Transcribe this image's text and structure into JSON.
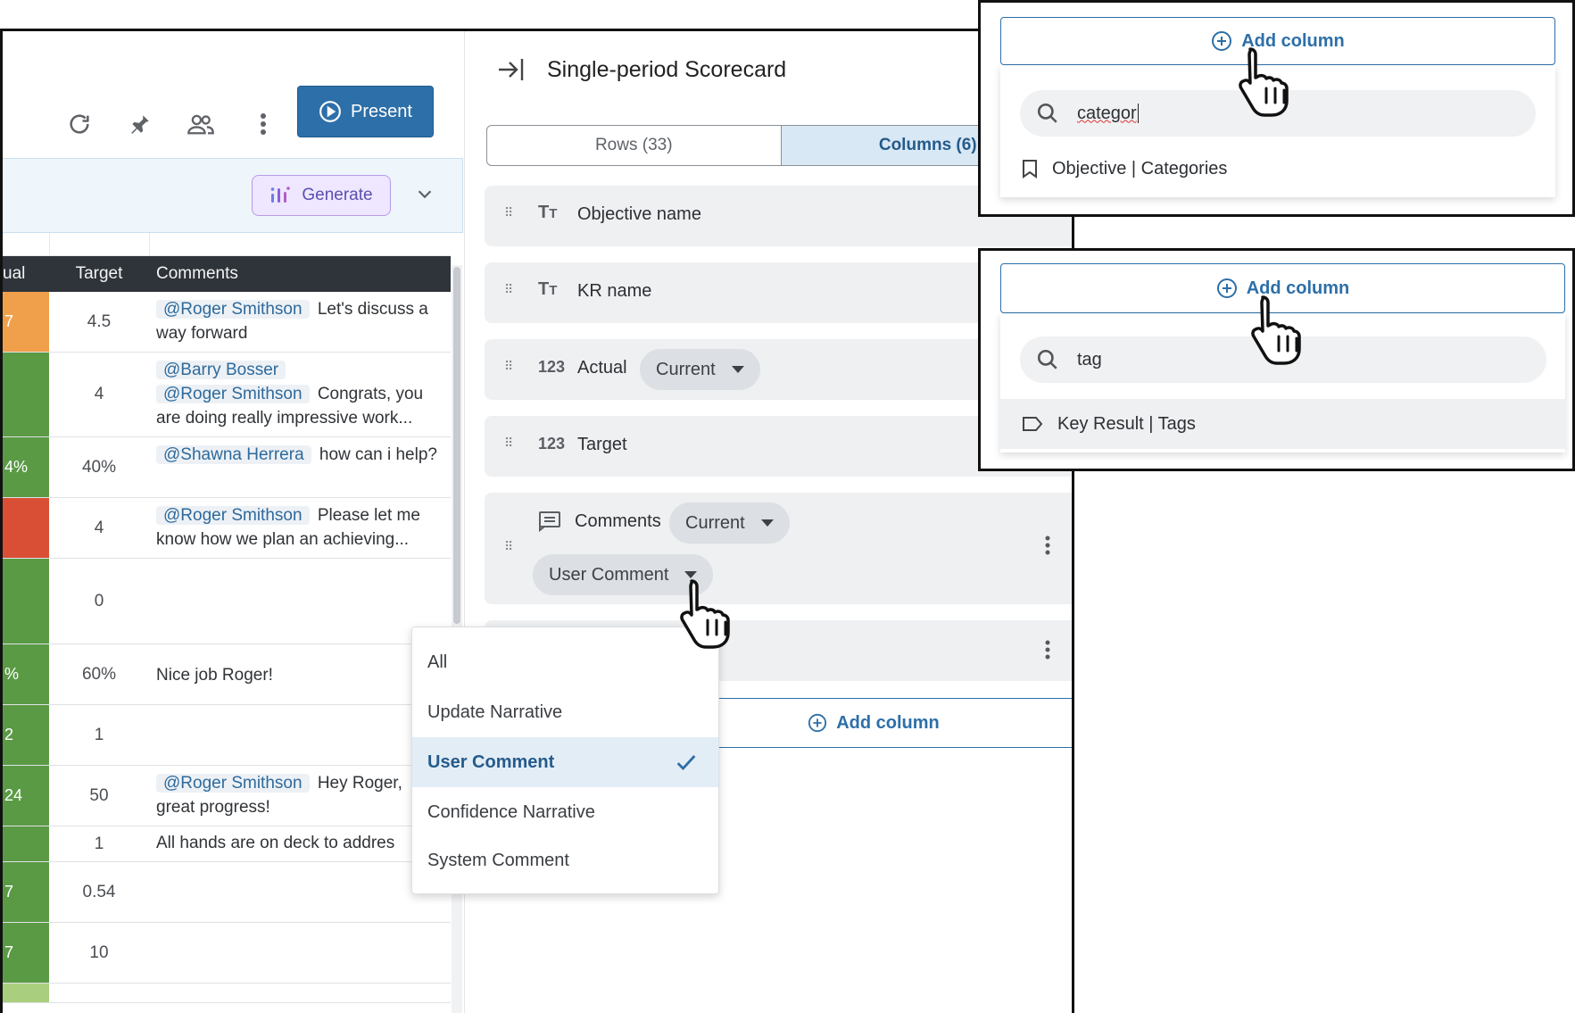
{
  "toolbar": {
    "present_label": "Present",
    "generate_label": "Generate"
  },
  "table": {
    "headers": {
      "actual": "ual",
      "target": "Target",
      "comments": "Comments"
    },
    "rows": [
      {
        "actual": "7",
        "actual_color": "#f0a04b",
        "target": "4.5",
        "mentions": [
          "@Roger Smithson"
        ],
        "text": "Let's discuss a way forward"
      },
      {
        "actual": "",
        "actual_color": "#5a9a45",
        "target": "4",
        "mentions": [
          "@Barry Bosser",
          "@Roger Smithson"
        ],
        "text": "Congrats, you are doing really impressive work..."
      },
      {
        "actual": "4%",
        "actual_color": "#5a9a45",
        "target": "40%",
        "mentions": [
          "@Shawna Herrera"
        ],
        "text": "how can i help?"
      },
      {
        "actual": "",
        "actual_color": "#d94f35",
        "target": "4",
        "mentions": [
          "@Roger Smithson"
        ],
        "text": "Please let me know how we plan an achieving..."
      },
      {
        "actual": "",
        "actual_color": "#5a9a45",
        "target": "0",
        "mentions": [],
        "text": ""
      },
      {
        "actual": "%",
        "actual_color": "#5a9a45",
        "target": "60%",
        "mentions": [],
        "text": "Nice job Roger!"
      },
      {
        "actual": "2",
        "actual_color": "#5a9a45",
        "target": "1",
        "mentions": [],
        "text": ""
      },
      {
        "actual": "24",
        "actual_color": "#5a9a45",
        "target": "50",
        "mentions": [
          "@Roger Smithson"
        ],
        "text": "Hey Roger, great progress!"
      },
      {
        "actual": "",
        "actual_color": "#5a9a45",
        "target": "1",
        "mentions": [],
        "text": "All hands are on deck to addres"
      },
      {
        "actual": "7",
        "actual_color": "#5a9a45",
        "target": "0.54",
        "mentions": [],
        "text": ""
      },
      {
        "actual": "7",
        "actual_color": "#5a9a45",
        "target": "10",
        "mentions": [],
        "text": ""
      },
      {
        "actual": "",
        "actual_color": "#a9cf7e",
        "target": "",
        "mentions": [],
        "text": ""
      }
    ]
  },
  "panel": {
    "title": "Single-period Scorecard",
    "tabs": {
      "rows": "Rows (33)",
      "columns": "Columns (6)"
    },
    "columns": [
      {
        "icon": "TT",
        "label": "Objective name"
      },
      {
        "icon": "TT",
        "label": "KR name"
      },
      {
        "icon": "123",
        "label": "Actual",
        "chip": "Current"
      },
      {
        "icon": "123",
        "label": "Target"
      },
      {
        "icon": "comment",
        "label": "Comments",
        "chip": "Current",
        "chip2": "User Comment"
      }
    ],
    "add_column_label": "Add column"
  },
  "dropdown": {
    "items": [
      "All",
      "Update Narrative",
      "User Comment",
      "Confidence Narrative",
      "System Comment"
    ],
    "selected": "User Comment"
  },
  "inset_top": {
    "add_column_label": "Add column",
    "search_value": "categor",
    "result": "Objective | Categories"
  },
  "inset_bottom": {
    "add_column_label": "Add column",
    "search_value": "tag",
    "result": "Key Result | Tags"
  },
  "colors": {
    "primary": "#2d6fa8",
    "header_dark": "#2f343a",
    "orange": "#f0a04b",
    "green": "#5a9a45",
    "red": "#d94f35",
    "light_green": "#a9cf7e"
  }
}
